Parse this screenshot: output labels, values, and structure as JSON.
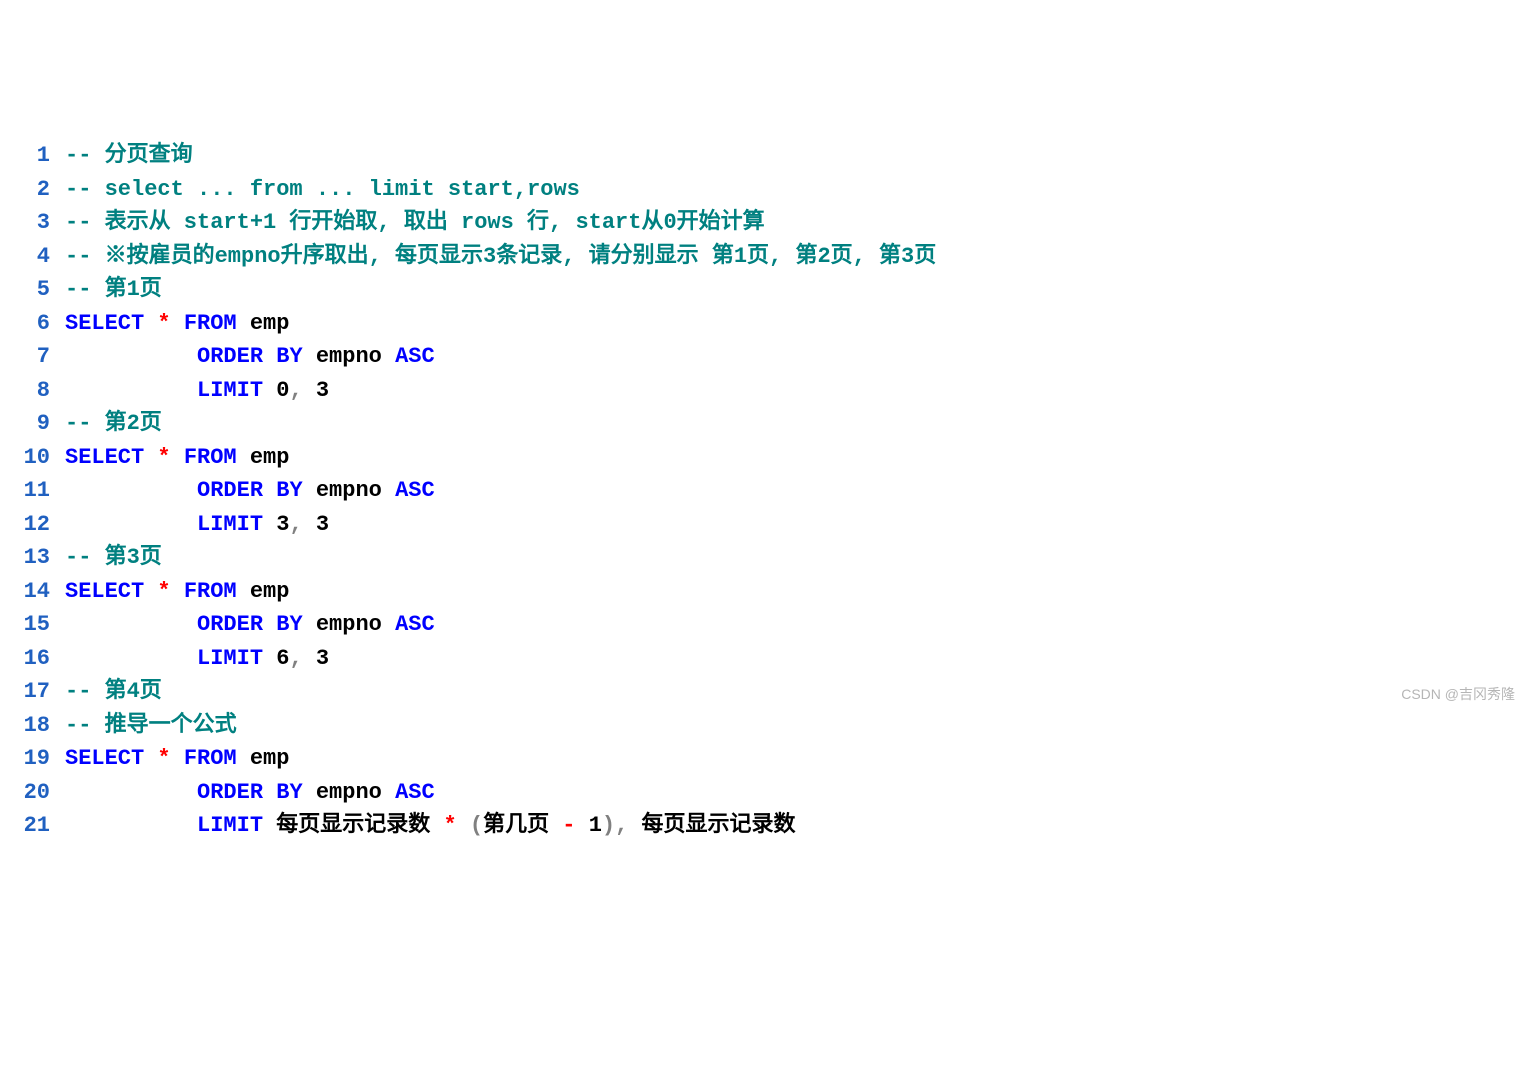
{
  "lines": {
    "n1": "1",
    "n2": "2",
    "n3": "3",
    "n4": "4",
    "n5": "5",
    "n6": "6",
    "n7": "7",
    "n8": "8",
    "n9": "9",
    "n10": "10",
    "n11": "11",
    "n12": "12",
    "n13": "13",
    "n14": "14",
    "n15": "15",
    "n16": "16",
    "n17": "17",
    "n18": "18",
    "n19": "19",
    "n20": "20",
    "n21": "21"
  },
  "c": {
    "l1": "-- 分页查询",
    "l2": "-- select ... from ... limit start,rows",
    "l3": "-- 表示从 start+1 行开始取, 取出 rows 行, start从0开始计算",
    "l4": "-- ※按雇员的empno升序取出, 每页显示3条记录, 请分别显示 第1页, 第2页, 第3页",
    "l5": "-- 第1页",
    "l9": "-- 第2页",
    "l13": "-- 第3页",
    "l17": "-- 第4页",
    "l18": "-- 推导一个公式",
    "kw_select": "SELECT",
    "kw_from": "FROM",
    "kw_orderby": "ORDER BY",
    "kw_asc": "ASC",
    "kw_limit": "LIMIT",
    "star": "*",
    "emp": "emp",
    "empno": "empno",
    "zero": "0",
    "three": "3",
    "six": "6",
    "comma": ",",
    "l21_a": "每页显示记录数",
    "l21_paren_open": "(",
    "l21_mid": "第几页",
    "l21_minus": "-",
    "l21_one": "1",
    "l21_paren_close": ")",
    "l21_b": "每页显示记录数"
  },
  "watermark": "CSDN @吉冈秀隆"
}
